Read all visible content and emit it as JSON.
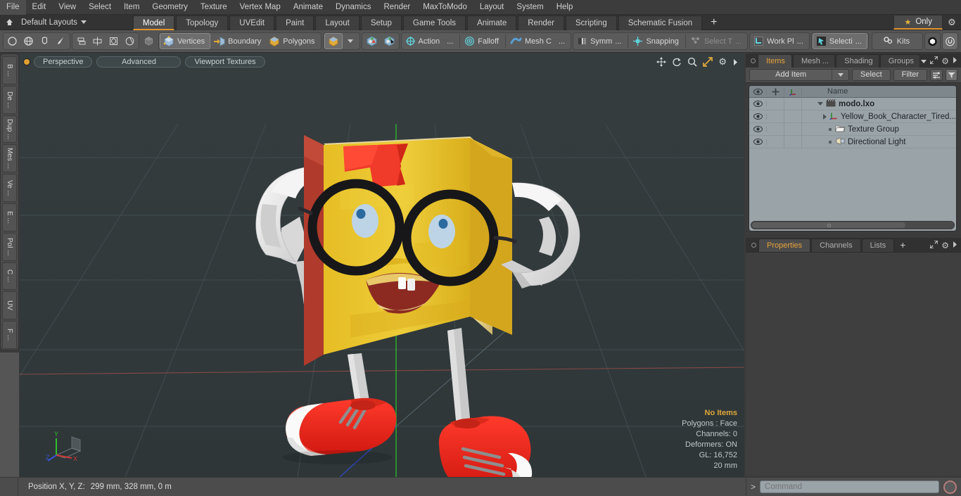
{
  "menu": {
    "items": [
      "File",
      "Edit",
      "View",
      "Select",
      "Item",
      "Geometry",
      "Texture",
      "Vertex Map",
      "Animate",
      "Dynamics",
      "Render",
      "MaxToModo",
      "Layout",
      "System",
      "Help"
    ]
  },
  "layoutbar": {
    "home_icon": "home-icon",
    "default_layouts": "Default Layouts",
    "tabs": [
      {
        "label": "Model",
        "active": true
      },
      {
        "label": "Topology",
        "active": false
      },
      {
        "label": "UVEdit",
        "active": false
      },
      {
        "label": "Paint",
        "active": false
      },
      {
        "label": "Layout",
        "active": false
      },
      {
        "label": "Setup",
        "active": false
      },
      {
        "label": "Game Tools",
        "active": false
      },
      {
        "label": "Animate",
        "active": false
      },
      {
        "label": "Render",
        "active": false
      },
      {
        "label": "Scripting",
        "active": false
      },
      {
        "label": "Schematic Fusion",
        "active": false
      }
    ],
    "add_tab": "+",
    "only_label": "Only",
    "star_icon": "star-icon",
    "gear_icon": "gear-icon"
  },
  "toolbar": {
    "shape_tools": [
      {
        "name": "circle-tool-icon"
      },
      {
        "name": "sphere-tool-icon"
      },
      {
        "name": "cone-tool-icon"
      },
      {
        "name": "pen-tool-icon"
      }
    ],
    "align_tools": [
      {
        "name": "stack-align-icon"
      },
      {
        "name": "center-align-icon"
      },
      {
        "name": "box-align-icon"
      },
      {
        "name": "radial-align-icon"
      }
    ],
    "selection_mode_icon": "cube-select-icon",
    "selection_modes": [
      {
        "label": "Vertices",
        "icon": "vertices-icon",
        "selected": true
      },
      {
        "label": "Boundary",
        "icon": "boundary-icon",
        "selected": false
      },
      {
        "label": "Polygons",
        "icon": "polygons-icon",
        "selected": false
      }
    ],
    "item_mode_icon": "item-cube-icon",
    "item_mode_caret": "chevron-down-icon",
    "snap_icons": [
      "mesh-paint-icon",
      "mesh-edit-icon"
    ],
    "modifiers": [
      {
        "label": "Action",
        "icon": "action-center-icon",
        "ellipsis": "..."
      },
      {
        "label": "Falloff",
        "icon": "falloff-icon",
        "ellipsis": ""
      },
      {
        "label": "Mesh C",
        "icon": "mesh-constraint-icon",
        "ellipsis": "..."
      }
    ],
    "right_group": [
      {
        "label": "Symm",
        "icon": "symmetry-icon",
        "ellipsis": "...",
        "dim": false
      },
      {
        "label": "Snapping",
        "icon": "snapping-icon",
        "ellipsis": "",
        "dim": false
      },
      {
        "label": "Select T",
        "icon": "select-through-icon",
        "ellipsis": "...",
        "dim": true
      }
    ],
    "workplane": {
      "label": "Work Pl",
      "icon": "workplane-icon",
      "ellipsis": "..."
    },
    "selection_set": {
      "label": "Selecti",
      "icon": "selection-arrow-icon",
      "ellipsis": "..."
    },
    "kits": {
      "label": "Kits",
      "icon": "kits-gears-icon"
    },
    "plugin_icons": [
      "modo-bridge-icon",
      "unreal-engine-icon"
    ]
  },
  "left_tabs": [
    "B ...",
    "De ...",
    "Dup ...",
    "Mes ...",
    "Ve ...",
    "E ...",
    "Pol ...",
    "C ...",
    "UV",
    "F ..."
  ],
  "viewport": {
    "dot_icon": "viewport-options-dot",
    "buttons": [
      "Perspective",
      "Advanced",
      "Viewport Textures"
    ],
    "tools": [
      "move-viewport-icon",
      "rotate-viewport-icon",
      "zoom-viewport-icon",
      "fit-viewport-icon",
      "viewport-gear-icon",
      "viewport-more-icon"
    ],
    "stats": {
      "selection": "No Items",
      "polygons": "Polygons : Face",
      "channels": "Channels: 0",
      "deformers": "Deformers: ON",
      "gl": "GL: 16,752",
      "scale": "20 mm"
    },
    "axis_labels": {
      "x": "X",
      "y": "Y",
      "z": "Z"
    },
    "colors": {
      "background": "#323a3c",
      "grid": "#444e50",
      "axis_x": "#9c5050",
      "axis_y": "#2fbf2f",
      "axis_z": "#3d52c8",
      "book_front": "#e8c22c",
      "book_side": "#d9a81f",
      "book_spine": "#a83a2f",
      "bookmark": "#f03a2a",
      "glasses": "#1a1a1a",
      "eye": "#b9d2e6",
      "pupil": "#2f6ea8",
      "mouth": "#8c2a22",
      "glove": "#e8e8e8",
      "shoe": "#ef2222",
      "shoe_toe": "#f2f2f2",
      "leg": "#c8c8c8"
    }
  },
  "right_panel": {
    "tabs": [
      {
        "label": "Items",
        "active": true
      },
      {
        "label": "Mesh ...",
        "active": false
      },
      {
        "label": "Shading",
        "active": false
      },
      {
        "label": "Groups",
        "active": false
      }
    ],
    "tab_controls": [
      "chevron-down-icon",
      "expand-icon",
      "gear-icon",
      "more-icon"
    ],
    "toolrow": {
      "add_item": "Add Item",
      "add_item_caret": "chevron-down-icon",
      "select": "Select",
      "filter": "Filter",
      "list_options_icon": "list-options-icon",
      "funnel_icon": "funnel-icon"
    },
    "list_header": {
      "eye_icon": "eye-icon",
      "lock_icon": "move-lock-icon",
      "axis_icon": "axis-icon",
      "name": "Name"
    },
    "items": [
      {
        "label": "modo.lxo",
        "icon": "scene-clapper-icon",
        "indent": 0,
        "bold": true,
        "twisty": "down"
      },
      {
        "label": "Yellow_Book_Character_Tired...",
        "icon": "mesh-axis-icon",
        "indent": 1,
        "bold": false,
        "twisty": "right"
      },
      {
        "label": "Texture Group",
        "icon": "folder-icon",
        "indent": 1,
        "bold": false,
        "twisty": "dot"
      },
      {
        "label": "Directional Light",
        "icon": "light-icon",
        "indent": 1,
        "bold": false,
        "twisty": "dot"
      }
    ],
    "properties_tabs": [
      {
        "label": "Properties",
        "active": true
      },
      {
        "label": "Channels",
        "active": false
      },
      {
        "label": "Lists",
        "active": false
      },
      {
        "label": "+",
        "active": false
      }
    ],
    "properties_controls": [
      "expand-icon",
      "gear-icon",
      "more-icon"
    ]
  },
  "statusbar": {
    "position_label": "Position X, Y, Z:",
    "position_value": "299 mm, 328 mm, 0 m"
  },
  "commandbar": {
    "prompt": ">",
    "placeholder": "Command",
    "value": "",
    "record_icon": "record-circle-icon"
  }
}
